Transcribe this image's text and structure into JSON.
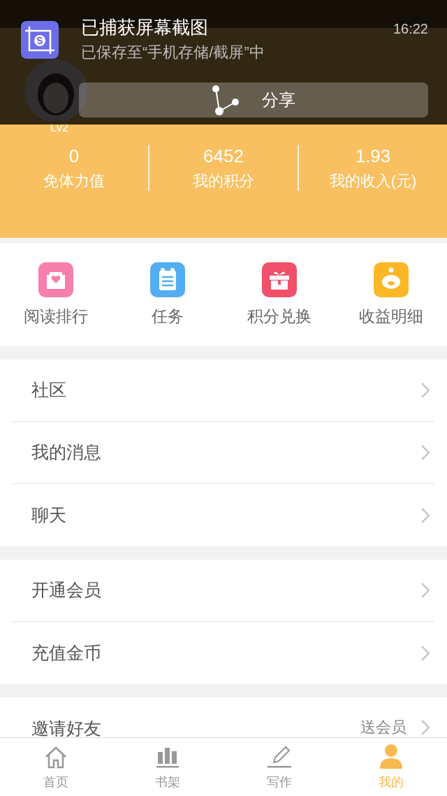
{
  "notification": {
    "title": "已捕获屏幕截图",
    "subtitle": "已保存至“手机存储/截屏”中",
    "time": "16:22",
    "action": "分享"
  },
  "profile": {
    "level": "Lv2"
  },
  "stats": [
    {
      "value": "0",
      "label": "免体力值"
    },
    {
      "value": "6452",
      "label": "我的积分"
    },
    {
      "value": "1.93",
      "label": "我的收入(元)"
    }
  ],
  "shortcuts": [
    {
      "label": "阅读排行",
      "kind": "ranking"
    },
    {
      "label": "任务",
      "kind": "tasks"
    },
    {
      "label": "积分兑换",
      "kind": "exchange"
    },
    {
      "label": "收益明细",
      "kind": "income"
    }
  ],
  "menu_groups": [
    [
      {
        "label": "社区"
      },
      {
        "label": "我的消息"
      },
      {
        "label": "聊天"
      }
    ],
    [
      {
        "label": "开通会员"
      },
      {
        "label": "充值金币"
      }
    ],
    [
      {
        "label": "邀请好友",
        "note": "送会员"
      }
    ]
  ],
  "tab_bar": [
    {
      "label": "首页",
      "kind": "home",
      "selected": false
    },
    {
      "label": "书架",
      "kind": "shelf",
      "selected": false
    },
    {
      "label": "写作",
      "kind": "write",
      "selected": false
    },
    {
      "label": "我的",
      "kind": "me",
      "selected": true
    }
  ]
}
